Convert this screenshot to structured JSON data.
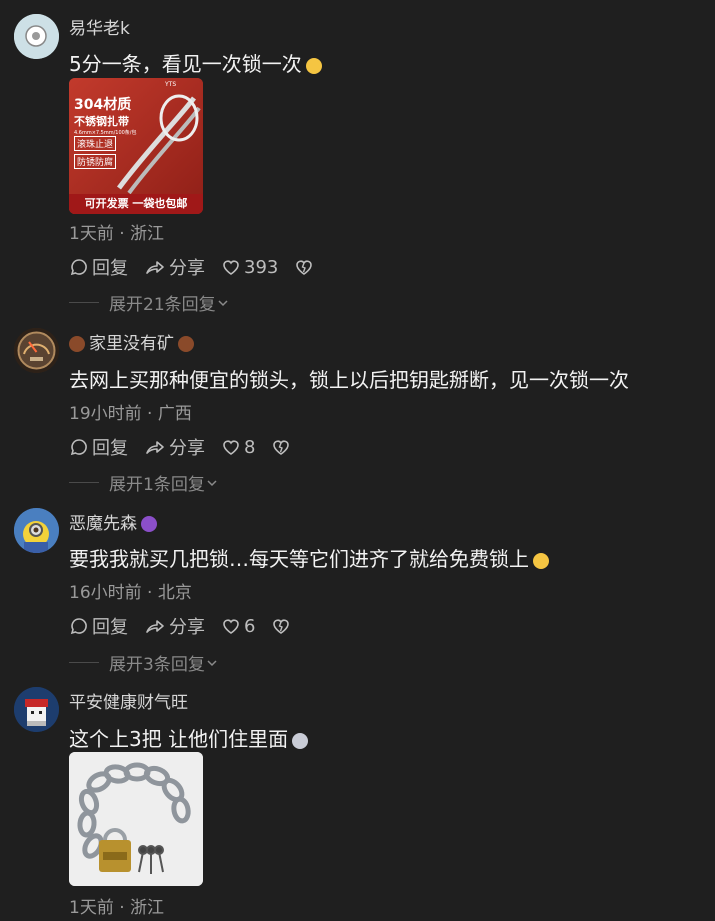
{
  "comments": [
    {
      "author": "易华老k",
      "text": "5分一条，看见一次锁一次",
      "emoji": "smile-emoji",
      "meta": "1天前 · 浙江",
      "actions": {
        "reply": "回复",
        "share": "分享",
        "likes": "393"
      },
      "expand": "展开21条回复",
      "image": {
        "line1": "304材质",
        "line2": "不锈钢扎带",
        "line3": "4.6mm×7.5mm/100条/包",
        "tag1": "滚珠止退",
        "tag2": "防锈防腐",
        "footer": "可开发票 一袋也包邮",
        "brand": "YTS"
      }
    },
    {
      "author": "家里没有矿",
      "text": "去网上买那种便宜的锁头，锁上以后把钥匙掰断，见一次锁一次",
      "meta": "19小时前 · 广西",
      "actions": {
        "reply": "回复",
        "share": "分享",
        "likes": "8"
      },
      "expand": "展开1条回复"
    },
    {
      "author": "恶魔先森",
      "text": "要我我就买几把锁…每天等它们进齐了就给免费锁上",
      "meta": "16小时前 · 北京",
      "actions": {
        "reply": "回复",
        "share": "分享",
        "likes": "6"
      },
      "expand": "展开3条回复"
    },
    {
      "author": "平安健康财气旺",
      "text": "这个上3把 让他们住里面",
      "meta": "1天前 · 浙江"
    }
  ]
}
